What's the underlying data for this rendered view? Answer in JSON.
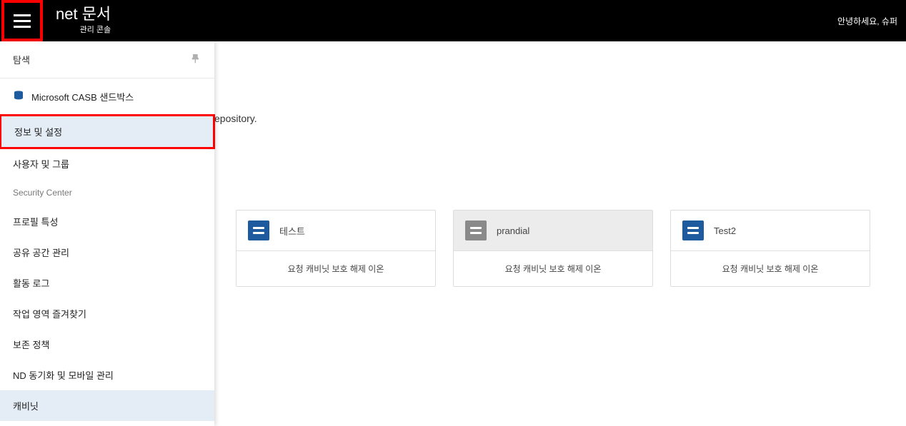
{
  "header": {
    "title": "net 문서",
    "subtitle": "관리 콘솔",
    "greeting": "안녕하세요, 슈퍼"
  },
  "sidebar": {
    "title": "탐색",
    "section_label": "Microsoft CASB 샌드박스",
    "items": {
      "info_settings": "정보 및 설정",
      "users_groups": "사용자 및 그룹",
      "security_center": "Security Center",
      "profile_traits": "프로필 특성",
      "shared_space": "공유 공간 관리",
      "activity_log": "활동 로그",
      "workspace_favorites": "작업 영역 즐겨찾기",
      "retention_policy": "보존 정책",
      "nd_sync": "ND 동기화 및 모바일 관리",
      "cabinet": "캐비닛"
    }
  },
  "content": {
    "partial_text": "epository."
  },
  "cards": [
    {
      "title": "테스트",
      "subtitle": "요청 캐비닛 보호 해제 이온"
    },
    {
      "title": "prandial",
      "subtitle": "요청 캐비닛 보호 해제 이온"
    },
    {
      "title": "Test2",
      "subtitle": "요청 캐비닛 보호 해제 이온"
    }
  ]
}
